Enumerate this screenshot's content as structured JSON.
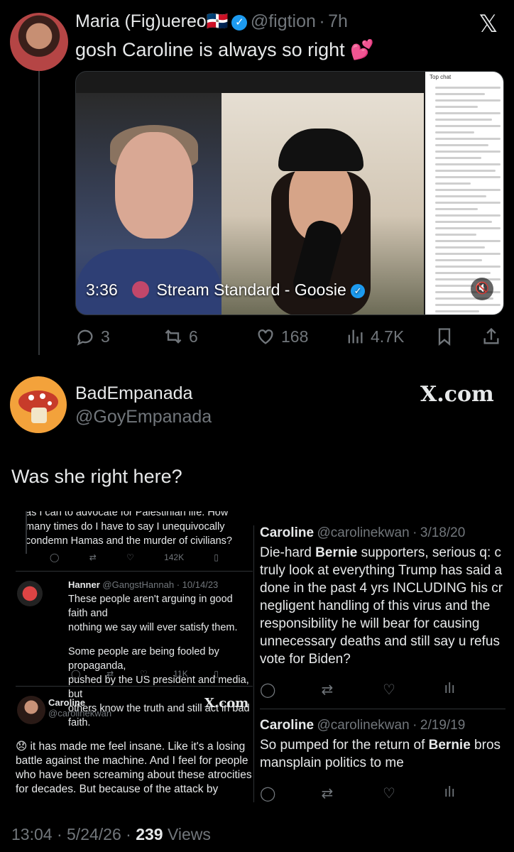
{
  "post1": {
    "author_name": "Maria (Fig)uereo🇩🇴",
    "handle": "@figtion",
    "time": "7h",
    "text": "gosh Caroline is always so right 💕",
    "media": {
      "duration": "3:36",
      "title": "Stream Standard - Goosie",
      "chat_header": "Top chat"
    },
    "actions": {
      "replies": "3",
      "reposts": "6",
      "likes": "168",
      "views": "4.7K"
    }
  },
  "post2": {
    "author_name": "BadEmpanada",
    "handle": "@GoyEmpanada",
    "brand": "X.com",
    "text": "Was she right here?"
  },
  "embed_left": {
    "tweet1_lines": [
      "as I can to advocate for Palestinian life. How",
      "many times do I have to say I unequivocally",
      "condemn Hamas and the murder of civilians?"
    ],
    "tweet1_views": "142K",
    "reply": {
      "name": "Hanner",
      "handle": "@GangstHannah",
      "date": "10/14/23",
      "lines1": [
        "These people aren't arguing in good faith and",
        "nothing we say will ever satisfy them."
      ],
      "lines2": [
        "Some people are being fooled by propaganda,",
        "pushed by the US president and media, but",
        "others know the truth and still act in bad faith."
      ],
      "views": "11K"
    },
    "caroline": {
      "name": "Caroline",
      "handle": "@carolinekwan",
      "brand": "X.com",
      "lines": [
        "😞 it has made me feel insane. Like it's a losing",
        "battle against the machine. And I feel for people",
        "who have been screaming about these atrocities",
        "for decades. But because of the attack by"
      ]
    }
  },
  "embed_right": {
    "tweet1": {
      "name": "Caroline",
      "handle": "@carolinekwan",
      "date": "3/18/20",
      "lines": [
        "Die-hard Bernie supporters, serious q: c",
        "truly look at everything Trump has said a",
        "done in the past 4 yrs INCLUDING his cr",
        "negligent handling of this virus and the",
        "responsibility he will bear for causing",
        "unnecessary deaths and still say u refus",
        "vote for Biden?"
      ]
    },
    "tweet2": {
      "name": "Caroline",
      "handle": "@carolinekwan",
      "date": "2/19/19",
      "lines": [
        "So pumped for the return of Bernie bros",
        "mansplain politics to me"
      ]
    }
  },
  "footer": {
    "time": "13:04",
    "date": "5/24/26",
    "views_count": "239",
    "views_label": "Views"
  },
  "colors": {
    "background": "#000000",
    "text": "#e7e9ea",
    "muted": "#71767b",
    "verified": "#1d9bf0"
  }
}
